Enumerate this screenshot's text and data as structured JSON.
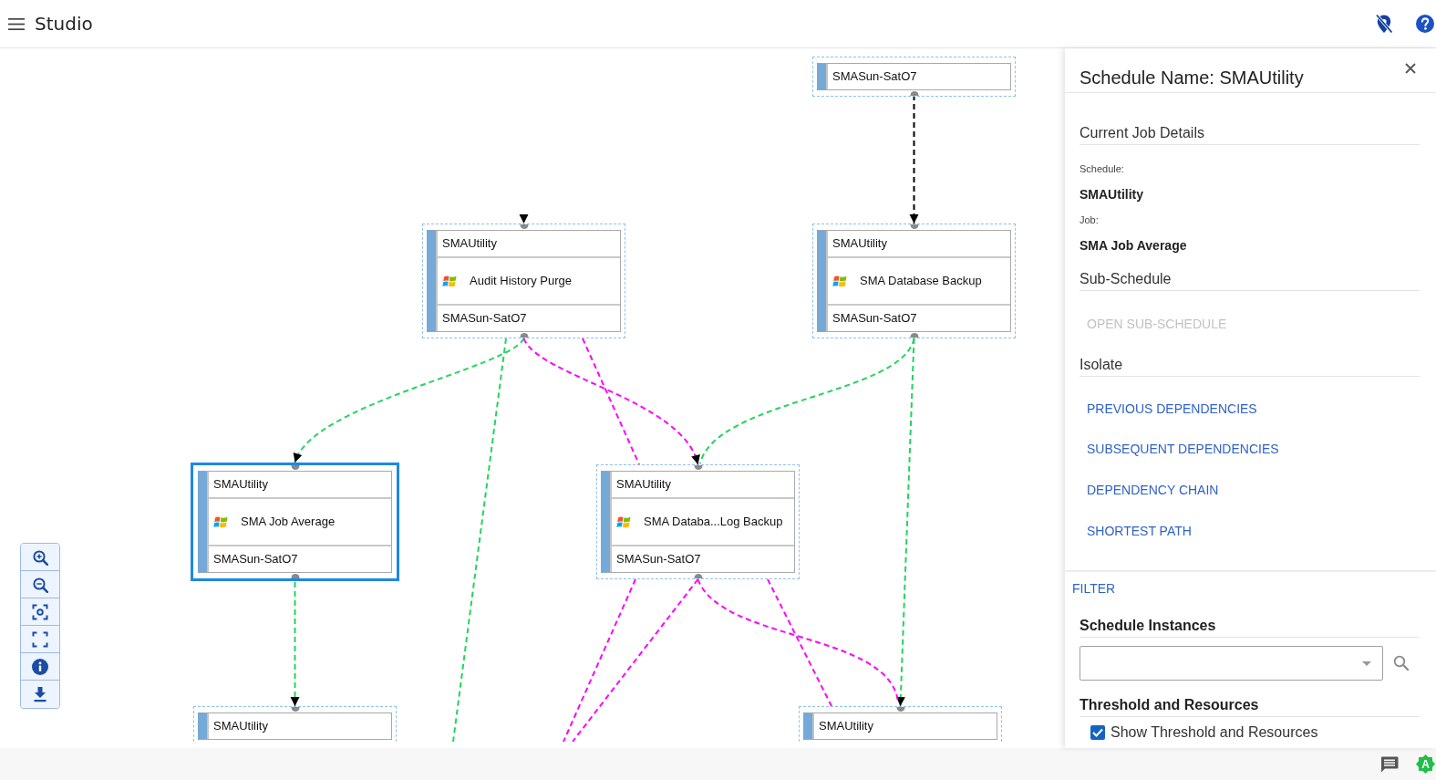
{
  "app_bar": {
    "title": "Studio"
  },
  "diagram": {
    "nodes": [
      {
        "calendar": "SMASun-SatO7",
        "selected": false
      },
      {
        "schedule": "SMAUtility",
        "job": "Audit History Purge",
        "calendar": "SMASun-SatO7",
        "selected": false
      },
      {
        "schedule": "SMAUtility",
        "job": "SMA Database Backup",
        "calendar": "SMASun-SatO7",
        "selected": false
      },
      {
        "schedule": "SMAUtility",
        "job": "SMA Job Average",
        "calendar": "SMASun-SatO7",
        "selected": true
      },
      {
        "schedule": "SMAUtility",
        "job": "SMA Databa...Log Backup",
        "calendar": "SMASun-SatO7",
        "selected": false
      },
      {
        "schedule": "SMAUtility",
        "selected": false
      },
      {
        "schedule": "SMAUtility",
        "selected": false
      }
    ],
    "dependencies": [
      {
        "color": "#000000",
        "arrow": true
      },
      {
        "color": "#000000",
        "arrow": true
      },
      {
        "color": "#22d45f",
        "arrow": true
      },
      {
        "color": "#ff00ff",
        "arrow": true
      },
      {
        "color": "#22d45f",
        "arrow": false
      },
      {
        "color": "#ff00ff",
        "arrow": false
      },
      {
        "color": "#22d45f",
        "arrow": false
      },
      {
        "color": "#22d45f",
        "arrow": true
      },
      {
        "color": "#22d45f",
        "arrow": true
      },
      {
        "color": "#ff00ff",
        "arrow": false
      },
      {
        "color": "#ff00ff",
        "arrow": false
      },
      {
        "color": "#ff00ff",
        "arrow": false
      },
      {
        "color": "#ff00ff",
        "arrow": false
      }
    ]
  },
  "details_panel": {
    "title": "Schedule Name: SMAUtility",
    "current_job": {
      "heading": "Current Job Details",
      "fields": [
        {
          "label": "Schedule:",
          "value": "SMAUtility"
        },
        {
          "label": "Job:",
          "value": "SMA Job Average"
        }
      ]
    },
    "sub_schedule": {
      "heading": "Sub-Schedule",
      "action": {
        "label": "OPEN SUB-SCHEDULE",
        "disabled": true
      }
    },
    "isolate": {
      "heading": "Isolate",
      "actions": [
        {
          "label": "PREVIOUS DEPENDENCIES",
          "disabled": false
        },
        {
          "label": "SUBSEQUENT DEPENDENCIES",
          "disabled": false
        },
        {
          "label": "DEPENDENCY CHAIN",
          "disabled": false
        },
        {
          "label": "SHORTEST PATH",
          "disabled": false
        }
      ]
    },
    "filter": {
      "label": "FILTER"
    },
    "schedule_instances": {
      "heading": "Schedule Instances"
    },
    "threshold": {
      "heading": "Threshold and Resources",
      "checkbox": {
        "label": "Show Threshold and Resources",
        "checked": true
      }
    }
  },
  "status_bar": {
    "badge": "A"
  }
}
